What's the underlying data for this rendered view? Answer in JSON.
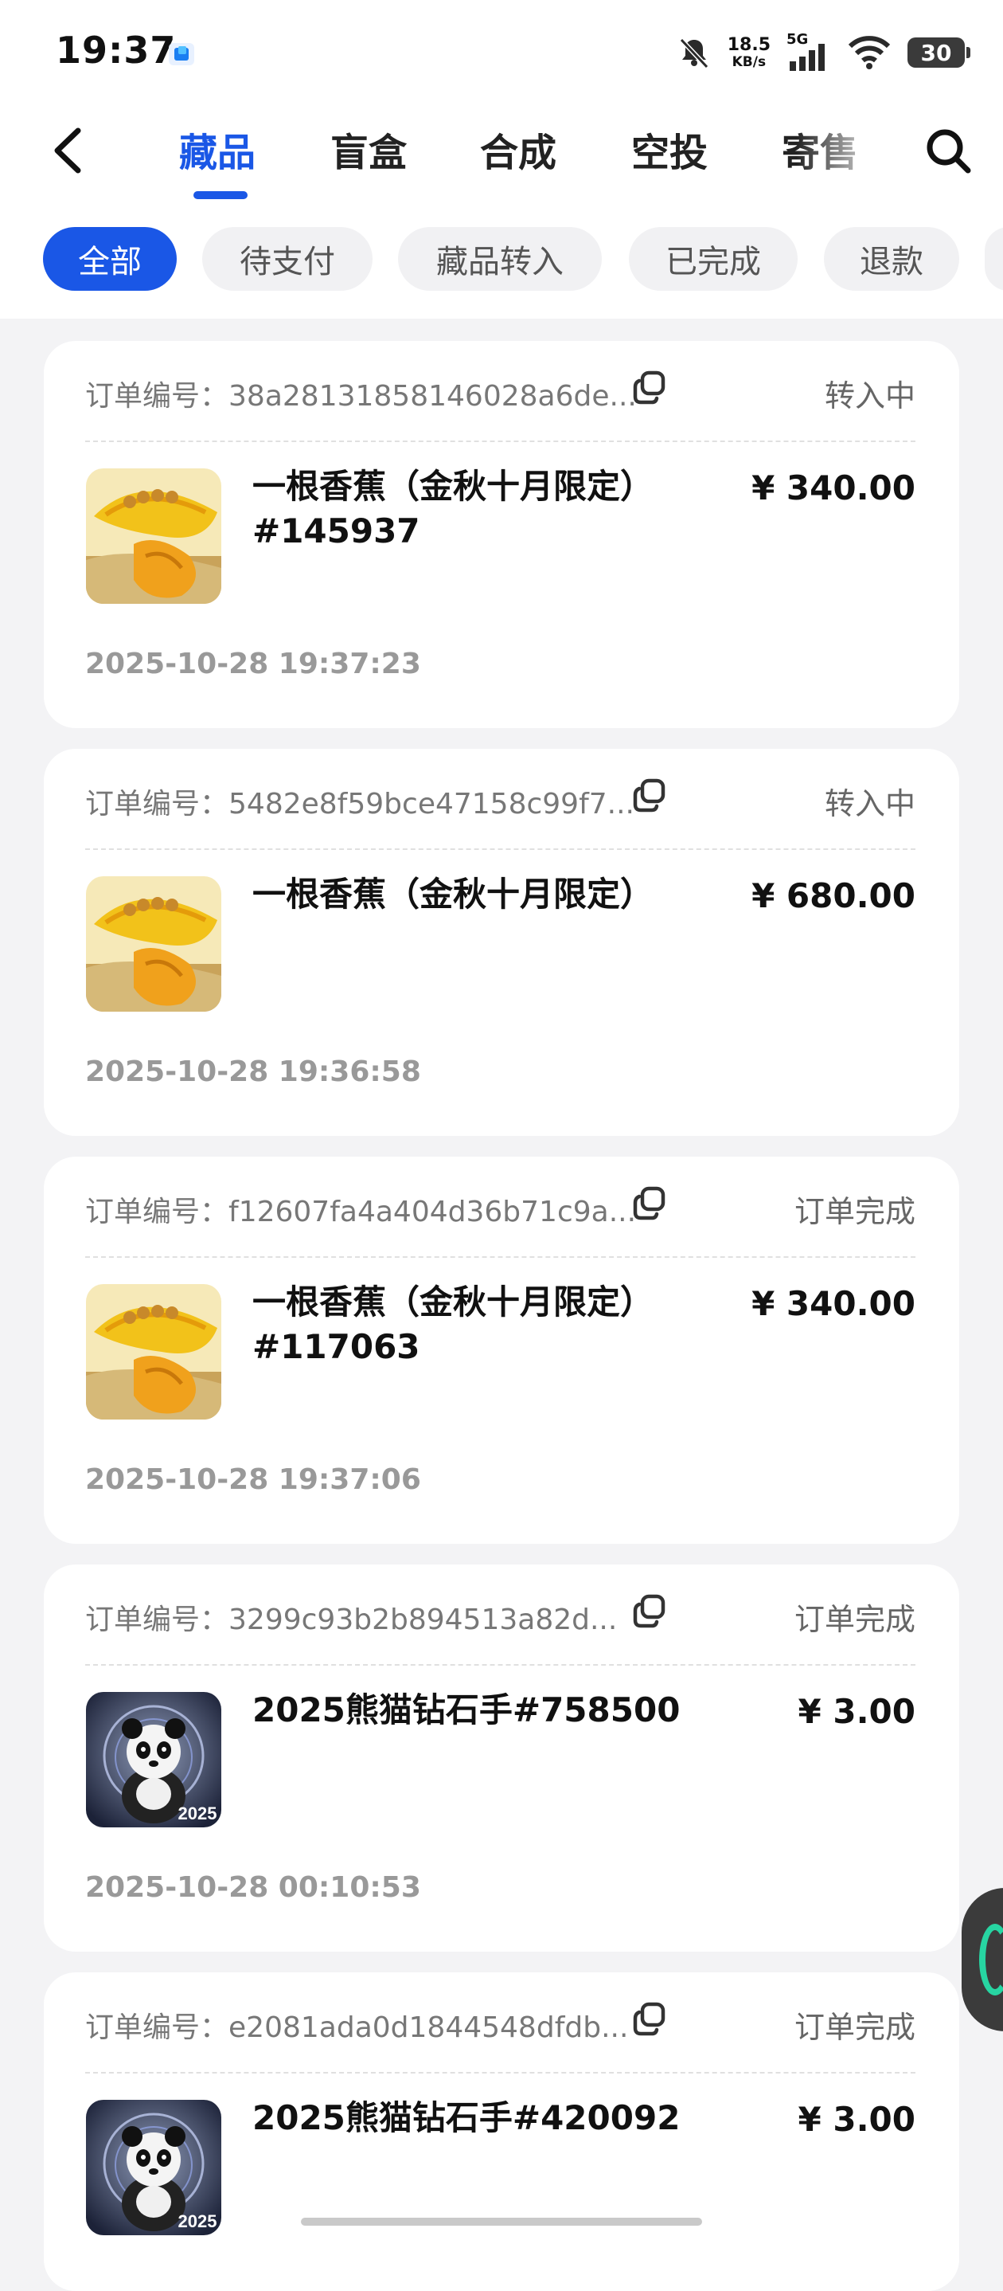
{
  "status_bar": {
    "time": "19:37",
    "net_speed_value": "18.5",
    "net_speed_unit": "KB/s",
    "signal_label": "5G",
    "battery": "30"
  },
  "nav": {
    "tabs": [
      {
        "label": "藏品",
        "active": true
      },
      {
        "label": "盲盒",
        "active": false
      },
      {
        "label": "合成",
        "active": false
      },
      {
        "label": "空投",
        "active": false
      },
      {
        "label": "寄售",
        "active": false
      }
    ]
  },
  "filters": [
    {
      "label": "全部",
      "active": true
    },
    {
      "label": "待支付",
      "active": false
    },
    {
      "label": "藏品转入",
      "active": false
    },
    {
      "label": "已完成",
      "active": false
    },
    {
      "label": "退款",
      "active": false
    }
  ],
  "order_label": "订单编号：",
  "orders": [
    {
      "order_no": "38a28131858146028a6de...",
      "status": "转入中",
      "name": "一根香蕉（金秋十月限定）#145937",
      "price": "¥ 340.00",
      "date": "2025-10-28 19:37:23",
      "thumb": "banana"
    },
    {
      "order_no": "5482e8f59bce47158c99f7...",
      "status": "转入中",
      "name": "一根香蕉（金秋十月限定）",
      "price": "¥ 680.00",
      "date": "2025-10-28 19:36:58",
      "thumb": "banana"
    },
    {
      "order_no": "f12607fa4a404d36b71c9a...",
      "status": "订单完成",
      "name": "一根香蕉（金秋十月限定）#117063",
      "price": "¥ 340.00",
      "date": "2025-10-28 19:37:06",
      "thumb": "banana"
    },
    {
      "order_no": "3299c93b2b894513a82d...",
      "status": "订单完成",
      "name": "2025熊猫钻石手#758500",
      "price": "¥ 3.00",
      "date": "2025-10-28 00:10:53",
      "thumb": "panda"
    },
    {
      "order_no": "e2081ada0d1844548dfdb...",
      "status": "订单完成",
      "name": "2025熊猫钻石手#420092",
      "price": "¥ 3.00",
      "date": "",
      "thumb": "panda"
    }
  ],
  "panda_thumb_text": "2025",
  "colors": {
    "accent": "#1a57e6",
    "background": "#f3f3f5"
  }
}
